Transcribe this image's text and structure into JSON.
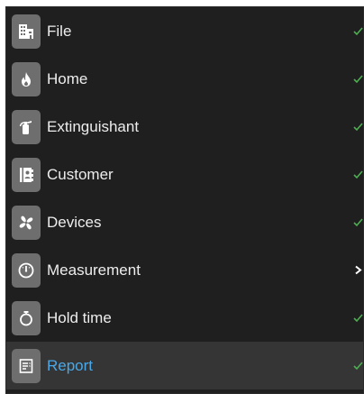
{
  "colors": {
    "background": "#1f1f1f",
    "active_row": "#353535",
    "icon_tile": "#6e6e6e",
    "label": "#ededed",
    "active_label": "#4aa8e8",
    "check": "#4caf50"
  },
  "menu": {
    "items": [
      {
        "label": "File",
        "icon": "building-icon",
        "status": "check"
      },
      {
        "label": "Home",
        "icon": "flame-icon",
        "status": "check"
      },
      {
        "label": "Extinguishant",
        "icon": "fire-extinguisher-icon",
        "status": "check"
      },
      {
        "label": "Customer",
        "icon": "contact-book-icon",
        "status": "check"
      },
      {
        "label": "Devices",
        "icon": "fan-icon",
        "status": "check"
      },
      {
        "label": "Measurement",
        "icon": "gauge-icon",
        "status": "chevron-right"
      },
      {
        "label": "Hold time",
        "icon": "stopwatch-icon",
        "status": "check"
      },
      {
        "label": "Report",
        "icon": "report-icon",
        "status": "check",
        "active": true
      }
    ]
  }
}
